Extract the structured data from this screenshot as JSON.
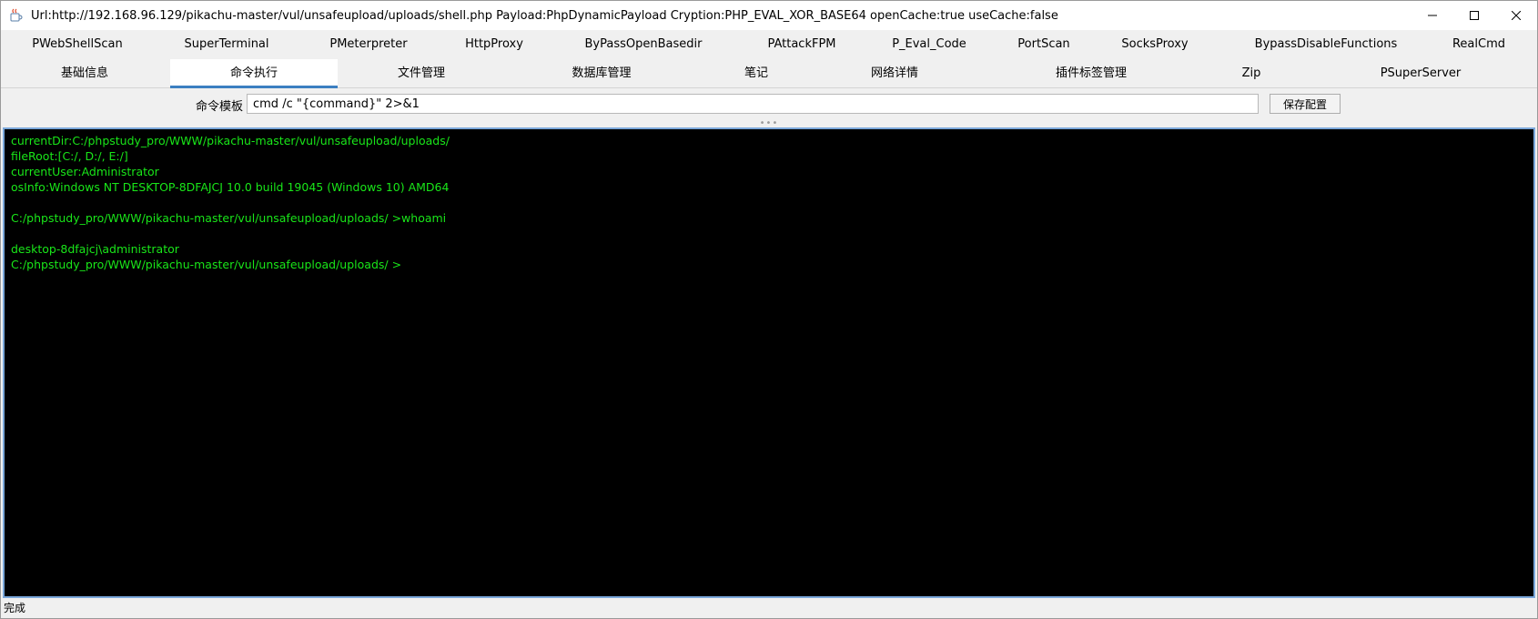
{
  "window": {
    "title": "Url:http://192.168.96.129/pikachu-master/vul/unsafeupload/uploads/shell.php Payload:PhpDynamicPayload Cryption:PHP_EVAL_XOR_BASE64 openCache:true useCache:false",
    "icon": "java-icon",
    "controls": [
      "minimize-icon",
      "maximize-icon",
      "close-icon"
    ]
  },
  "plugin_tabs": [
    "PWebShellScan",
    "SuperTerminal",
    "PMeterpreter",
    "HttpProxy",
    "ByPassOpenBasedir",
    "PAttackFPM",
    "P_Eval_Code",
    "PortScan",
    "SocksProxy",
    "BypassDisableFunctions",
    "RealCmd"
  ],
  "main_tabs": [
    "基础信息",
    "命令执行",
    "文件管理",
    "数据库管理",
    "笔记",
    "网络详情",
    "插件标签管理",
    "Zip",
    "PSuperServer"
  ],
  "active_main_tab": "命令执行",
  "command_template": {
    "label": "命令模板",
    "value": "cmd /c \"{command}\" 2>&1",
    "save_label": "保存配置"
  },
  "terminal": {
    "text_color": "#19e619",
    "lines": [
      "currentDir:C:/phpstudy_pro/WWW/pikachu-master/vul/unsafeupload/uploads/",
      "fileRoot:[C:/, D:/, E:/]",
      "currentUser:Administrator",
      "osInfo:Windows NT DESKTOP-8DFAJCJ 10.0 build 19045 (Windows 10) AMD64",
      "",
      "C:/phpstudy_pro/WWW/pikachu-master/vul/unsafeupload/uploads/ >whoami",
      "",
      "desktop-8dfajcj\\administrator",
      "C:/phpstudy_pro/WWW/pikachu-master/vul/unsafeupload/uploads/ >"
    ]
  },
  "status": {
    "text": "完成"
  },
  "colors": {
    "accent": "#3c7fc1",
    "terminal_bg": "#000000",
    "terminal_border": "#7aa7da"
  }
}
